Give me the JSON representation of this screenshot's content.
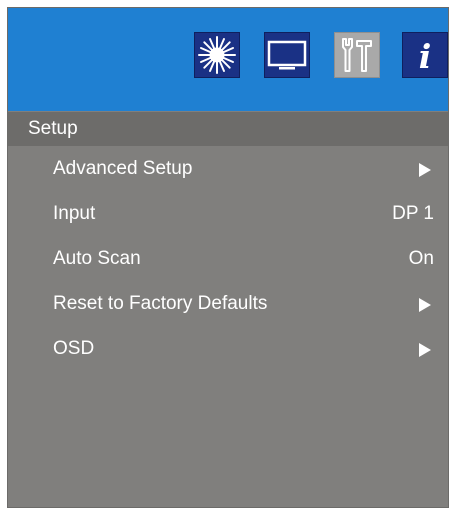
{
  "header": {
    "tabs": [
      {
        "id": "picture",
        "icon": "brightness-icon",
        "selected": false
      },
      {
        "id": "display",
        "icon": "monitor-icon",
        "selected": false
      },
      {
        "id": "setup",
        "icon": "tools-icon",
        "selected": true
      },
      {
        "id": "info",
        "icon": "info-icon",
        "glyph": "i",
        "selected": false
      }
    ]
  },
  "section": {
    "title": "Setup"
  },
  "menu": {
    "items": [
      {
        "label": "Advanced Setup",
        "kind": "submenu"
      },
      {
        "label": "Input",
        "kind": "value",
        "value": "DP 1"
      },
      {
        "label": "Auto Scan",
        "kind": "value",
        "value": "On"
      },
      {
        "label": "Reset to Factory Defaults",
        "kind": "submenu"
      },
      {
        "label": "OSD",
        "kind": "submenu"
      }
    ]
  },
  "colors": {
    "header_bg": "#1f80d2",
    "tab_bg": "#1a3185",
    "tab_selected_bg": "#a9a9a9",
    "panel_bg": "#807f7d",
    "title_bar_bg": "#6d6c6a",
    "text": "#ffffff"
  }
}
